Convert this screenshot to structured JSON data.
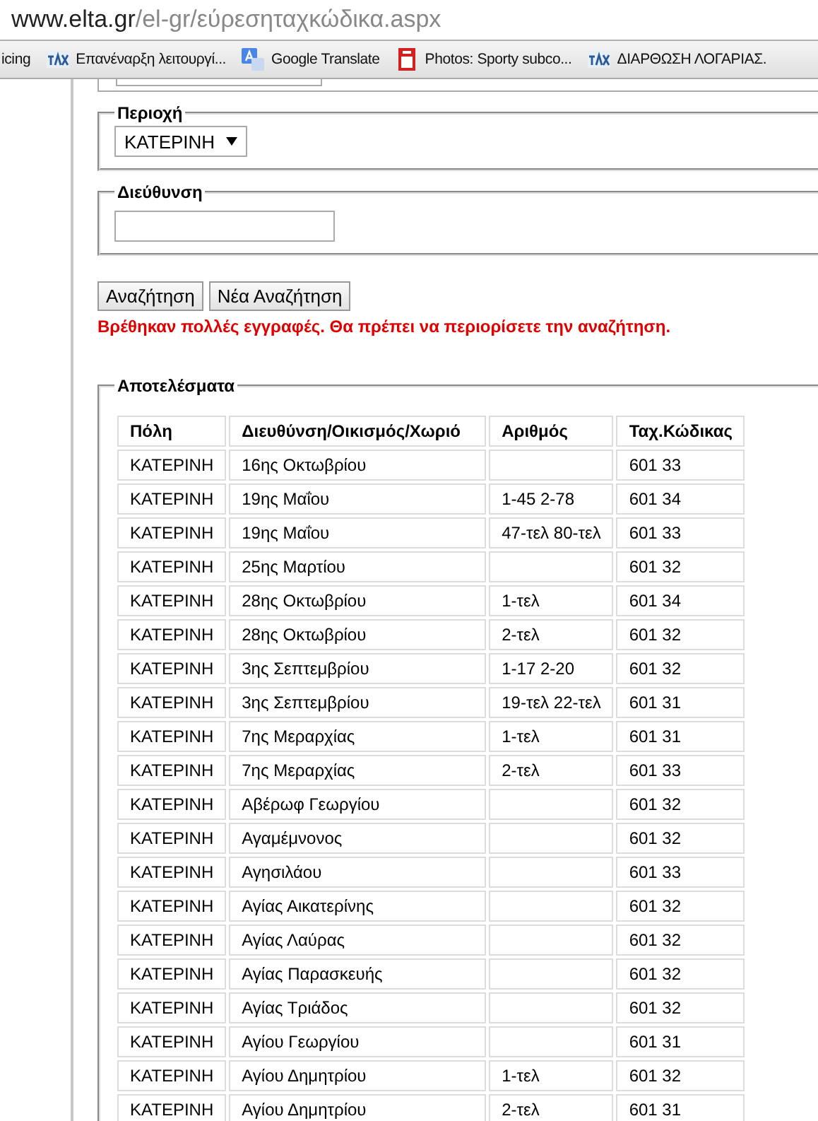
{
  "browser": {
    "url_host": "www.elta.gr",
    "url_path": "/el-gr/εύρεσηταχκώδικα.aspx"
  },
  "bookmarks": [
    {
      "kind": "plain",
      "label": "icing"
    },
    {
      "kind": "logo",
      "label": "Επανέναρξη λειτουργί..."
    },
    {
      "kind": "translate",
      "label": "Google Translate"
    },
    {
      "kind": "photo",
      "label": "Photos: Sporty subco..."
    },
    {
      "kind": "logo",
      "label": "ΔΙΑΡΘΩΣΗ ΛΟΓΑΡΙΑΣ."
    }
  ],
  "form": {
    "region": {
      "legend": "Περιοχή",
      "value": "ΚΑΤΕΡΙΝΗ"
    },
    "address": {
      "legend": "Διεύθυνση"
    },
    "buttons": [
      "Αναζήτηση",
      "Νέα Αναζήτηση"
    ],
    "message": "Βρέθηκαν πολλές εγγραφές. Θα πρέπει να περιορίσετε την αναζήτηση."
  },
  "results": {
    "legend": "Αποτελέσματα",
    "columns": [
      "Πόλη",
      "Διευθύνση/Οικισμός/Χωριό",
      "Αριθμός",
      "Ταχ.Κώδικας"
    ],
    "rows": [
      {
        "city": "ΚΑΤΕΡΙΝΗ",
        "street": "16ης Οκτωβρίου",
        "postcode": "601 33"
      },
      {
        "city": "ΚΑΤΕΡΙΝΗ",
        "street": "19ης Μαΐου",
        "number": "1-45 2-78",
        "postcode": "601 34"
      },
      {
        "city": "ΚΑΤΕΡΙΝΗ",
        "street": "19ης Μαΐου",
        "number": "47-τελ 80-τελ",
        "postcode": "601 33"
      },
      {
        "city": "ΚΑΤΕΡΙΝΗ",
        "street": "25ης Μαρτίου",
        "postcode": "601 32"
      },
      {
        "city": "ΚΑΤΕΡΙΝΗ",
        "street": "28ης Οκτωβρίου",
        "number": "1-τελ",
        "postcode": "601 34"
      },
      {
        "city": "ΚΑΤΕΡΙΝΗ",
        "street": "28ης Οκτωβρίου",
        "number": "2-τελ",
        "postcode": "601 32"
      },
      {
        "city": "ΚΑΤΕΡΙΝΗ",
        "street": "3ης Σεπτεμβρίου",
        "number": "1-17 2-20",
        "postcode": "601 32"
      },
      {
        "city": "ΚΑΤΕΡΙΝΗ",
        "street": "3ης Σεπτεμβρίου",
        "number": "19-τελ 22-τελ",
        "postcode": "601 31"
      },
      {
        "city": "ΚΑΤΕΡΙΝΗ",
        "street": "7ης Μεραρχίας",
        "number": "1-τελ",
        "postcode": "601 31"
      },
      {
        "city": "ΚΑΤΕΡΙΝΗ",
        "street": "7ης Μεραρχίας",
        "number": "2-τελ",
        "postcode": "601 33"
      },
      {
        "city": "ΚΑΤΕΡΙΝΗ",
        "street": "Αβέρωφ Γεωργίου",
        "postcode": "601 32"
      },
      {
        "city": "ΚΑΤΕΡΙΝΗ",
        "street": "Αγαμέμνονος",
        "postcode": "601 32"
      },
      {
        "city": "ΚΑΤΕΡΙΝΗ",
        "street": "Αγησιλάου",
        "postcode": "601 33"
      },
      {
        "city": "ΚΑΤΕΡΙΝΗ",
        "street": "Αγίας Αικατερίνης",
        "postcode": "601 32"
      },
      {
        "city": "ΚΑΤΕΡΙΝΗ",
        "street": "Αγίας Λαύρας",
        "postcode": "601 32"
      },
      {
        "city": "ΚΑΤΕΡΙΝΗ",
        "street": "Αγίας Παρασκευής",
        "postcode": "601 32"
      },
      {
        "city": "ΚΑΤΕΡΙΝΗ",
        "street": "Αγίας Τριάδος",
        "postcode": "601 32"
      },
      {
        "city": "ΚΑΤΕΡΙΝΗ",
        "street": "Αγίου Γεωργίου",
        "postcode": "601 31"
      },
      {
        "city": "ΚΑΤΕΡΙΝΗ",
        "street": "Αγίου Δημητρίου",
        "number": "1-τελ",
        "postcode": "601 32"
      },
      {
        "city": "ΚΑΤΕΡΙΝΗ",
        "street": "Αγίου Δημητρίου",
        "number": "2-τελ",
        "postcode": "601 31"
      }
    ]
  }
}
